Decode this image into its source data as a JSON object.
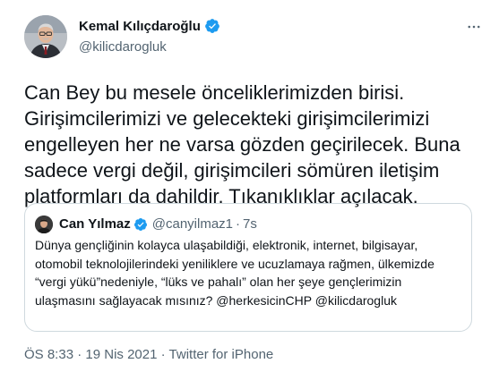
{
  "author": {
    "display_name": "Kemal Kılıçdaroğlu",
    "handle": "@kilicdarogluk"
  },
  "tweet": {
    "text": "Can Bey bu mesele önceliklerimizden birisi. Girişimcilerimizi ve gelecekteki girişimcilerimizi engelleyen her ne varsa gözden geçirilecek. Buna sadece vergi değil, girişimcileri sömüren iletişim platformları da dahildir. Tıkanıklıklar açılacak."
  },
  "quoted": {
    "display_name": "Can Yılmaz",
    "handle": "@canyilmaz1",
    "separator": "·",
    "time": "7s",
    "text": "Dünya gençliğinin kolayca ulaşabildiği, elektronik, internet, bilgisayar, otomobil teknolojilerindeki yeniliklere ve ucuzlamaya rağmen, ülkemizde  “vergi yükü”nedeniyle,  “lüks ve pahalı” olan her şeye gençlerimizin ulaşmasını sağlayacak mısınız? @herkesicinCHP @kilicdarogluk"
  },
  "meta": {
    "time": "ÖS 8:33",
    "separator1": "·",
    "date": "19 Nis 2021",
    "separator2": "·",
    "source": "Twitter for iPhone"
  },
  "colors": {
    "text": "#0f1419",
    "secondary": "#536471",
    "verified": "#1d9bf0",
    "border": "#cfd9de"
  },
  "icons": [
    "verified-badge-icon",
    "more-options-icon"
  ]
}
